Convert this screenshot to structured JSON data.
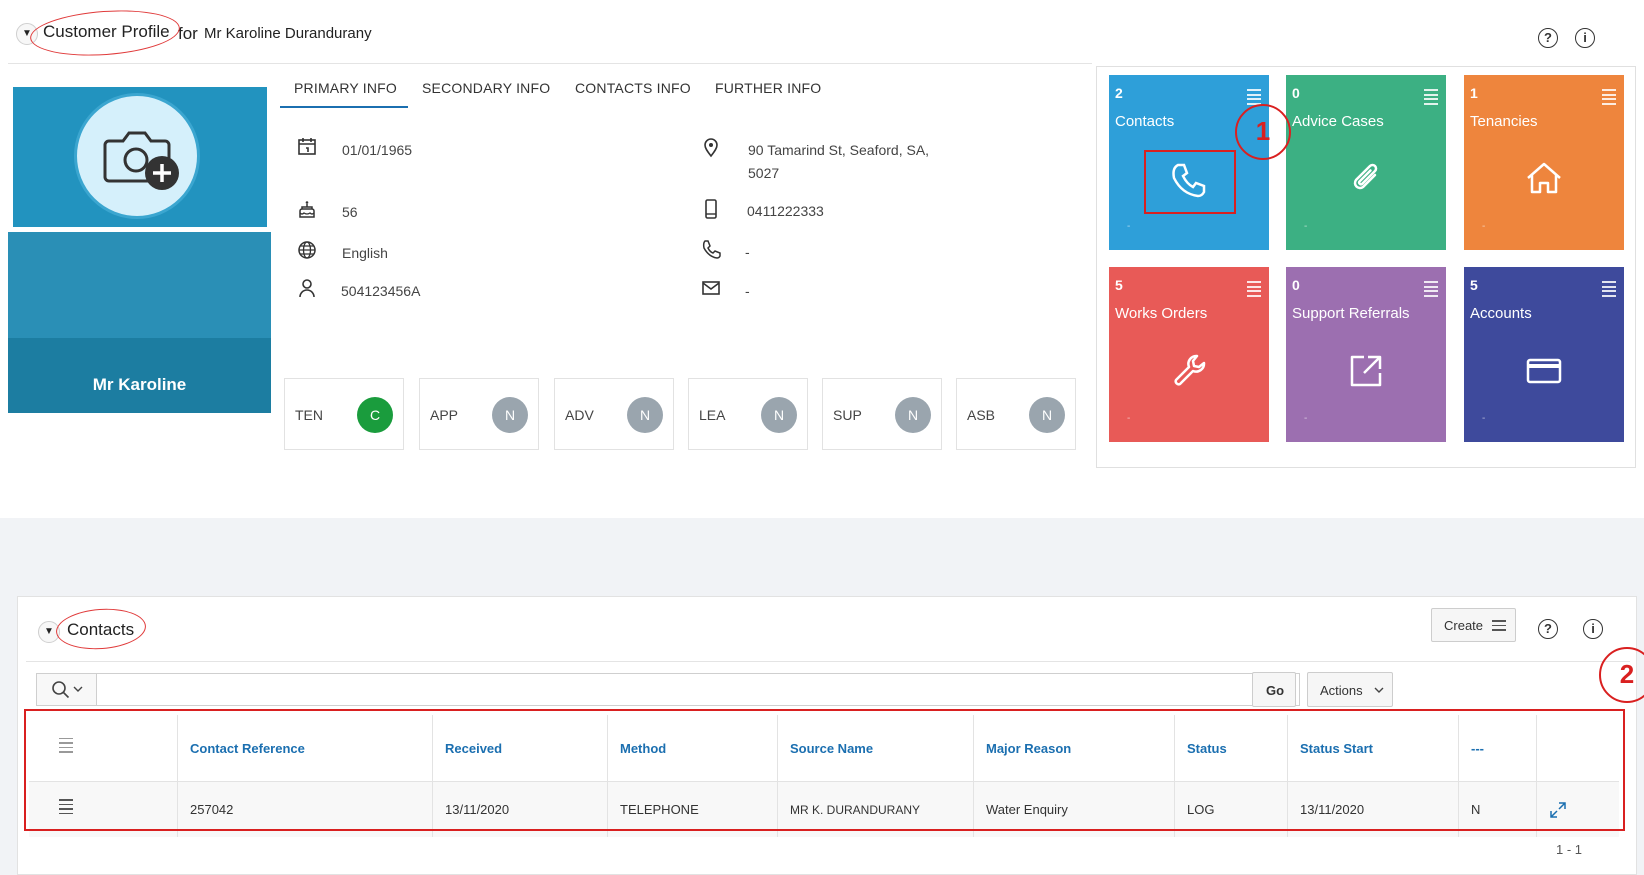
{
  "header": {
    "title": "Customer Profile",
    "subtitle_prefix": "for",
    "customer_name": "Mr Karoline Durandurany"
  },
  "avatar": {
    "name": "Mr  Karoline"
  },
  "tabs": [
    {
      "label": "PRIMARY INFO",
      "active": true
    },
    {
      "label": "SECONDARY INFO"
    },
    {
      "label": "CONTACTS INFO"
    },
    {
      "label": "FURTHER INFO"
    }
  ],
  "primary_info": {
    "dob": "01/01/1965",
    "age": "56",
    "language": "English",
    "id_number": "504123456A",
    "address_line1": "90 Tamarind St, Seaford, SA,",
    "address_line2": "5027",
    "mobile": "0411222333",
    "phone": "-",
    "email": "-"
  },
  "flags": [
    {
      "code": "TEN",
      "value": "C"
    },
    {
      "code": "APP",
      "value": "N"
    },
    {
      "code": "ADV",
      "value": "N"
    },
    {
      "code": "LEA",
      "value": "N"
    },
    {
      "code": "SUP",
      "value": "N"
    },
    {
      "code": "ASB",
      "value": "N"
    }
  ],
  "tiles": [
    {
      "count": "2",
      "label": "Contacts",
      "color": "#2e9fd9",
      "icon": "phone-icon",
      "dash": "-"
    },
    {
      "count": "0",
      "label": "Advice Cases",
      "color": "#3cb083",
      "icon": "paperclip-icon",
      "dash": "-"
    },
    {
      "count": "1",
      "label": "Tenancies",
      "color": "#ee853d",
      "icon": "home-icon",
      "dash": "-"
    },
    {
      "count": "5",
      "label": "Works Orders",
      "color": "#e85a57",
      "icon": "wrench-icon",
      "dash": "-"
    },
    {
      "count": "0",
      "label": "Support Referrals",
      "color": "#9c6fb0",
      "icon": "external-link-icon",
      "dash": "-"
    },
    {
      "count": "5",
      "label": "Accounts",
      "color": "#3e4a9c",
      "icon": "credit-card-icon",
      "dash": "-"
    }
  ],
  "contacts": {
    "title": "Contacts",
    "create_label": "Create",
    "go_label": "Go",
    "actions_label": "Actions",
    "pagination": "1 - 1",
    "columns": [
      "Contact Reference",
      "Received",
      "Method",
      "Source Name",
      "Major Reason",
      "Status",
      "Status Start",
      "---"
    ],
    "rows": [
      [
        "257042",
        "13/11/2020",
        "TELEPHONE",
        "MR K. DURANDURANY",
        "Water Enquiry",
        "LOG",
        "13/11/2020",
        "N"
      ]
    ]
  },
  "annotations": {
    "marker1": "1",
    "marker2": "2"
  },
  "colors": {
    "accent": "#1b6fb0",
    "annotation": "#d92020",
    "avatar_blue": "#2293bf"
  }
}
